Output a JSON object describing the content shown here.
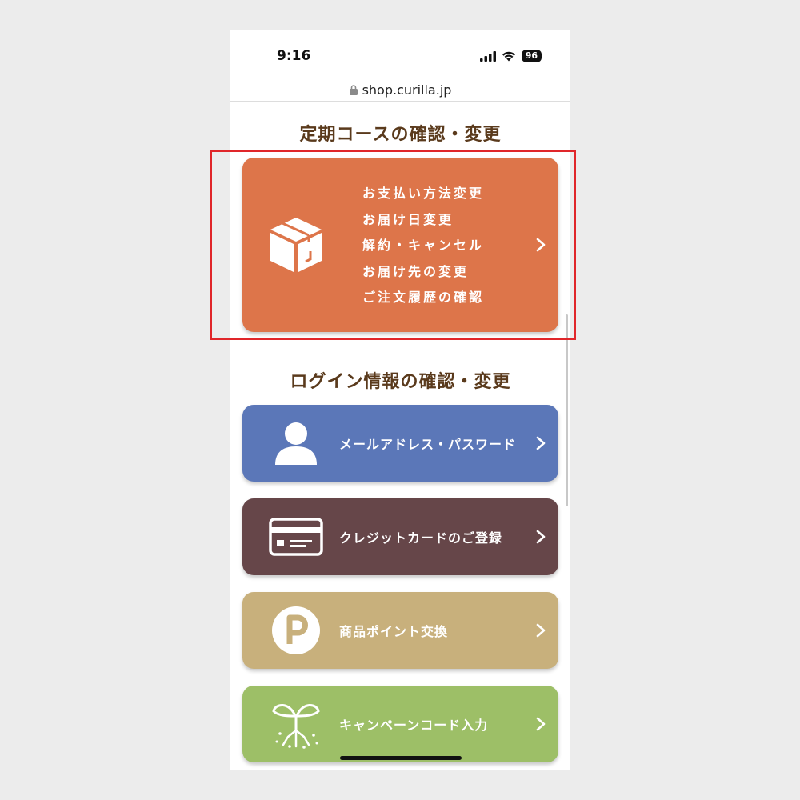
{
  "status_bar": {
    "time": "9:16",
    "battery": "96"
  },
  "url_bar": {
    "url": "shop.curilla.jp"
  },
  "course_section": {
    "title": "定期コースの確認・変更",
    "card": {
      "color": "#dd754a",
      "icon": "box-icon",
      "items": [
        "お支払い方法変更",
        "お届け日変更",
        "解約・キャンセル",
        "お届け先の変更",
        "ご注文履歴の確認"
      ]
    }
  },
  "login_section": {
    "title": "ログイン情報の確認・変更",
    "cards": [
      {
        "label": "メールアドレス・パスワード",
        "color": "#5b77b8",
        "icon": "person-icon"
      },
      {
        "label": "クレジットカードのご登録",
        "color": "#664649",
        "icon": "credit-card-icon"
      },
      {
        "label": "商品ポイント交換",
        "color": "#c8b07c",
        "icon": "point-p-icon"
      },
      {
        "label": "キャンペーンコード入力",
        "color": "#9dbf67",
        "icon": "sprout-icon"
      }
    ]
  },
  "colors": {
    "title_text": "#5a3a1c",
    "highlight": "#e0262a",
    "background": "#ececec"
  }
}
